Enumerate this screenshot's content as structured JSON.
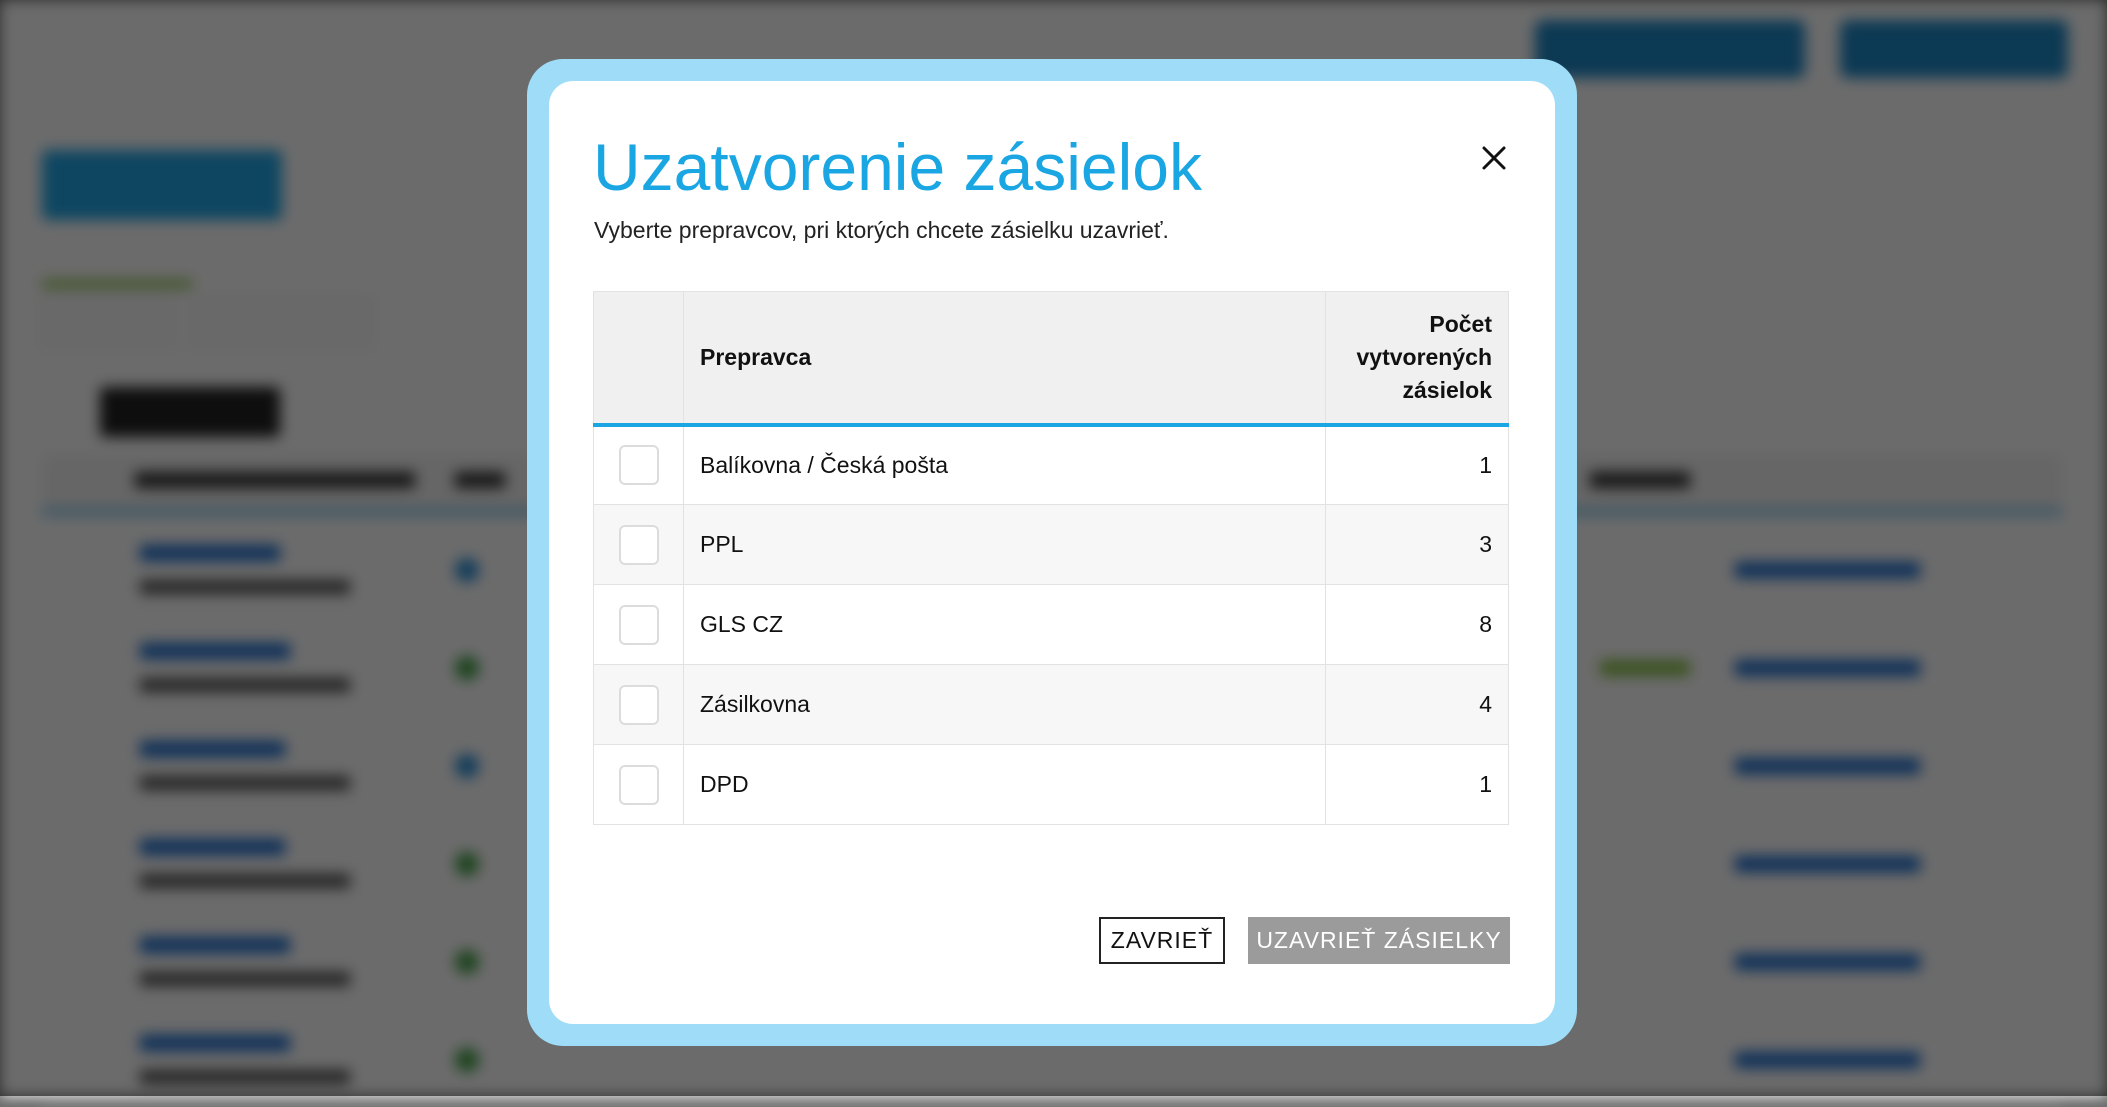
{
  "modal": {
    "title": "Uzatvorenie zásielok",
    "subtitle": "Vyberte prepravcov, pri ktorých chcete zásielku uzavrieť.",
    "table": {
      "header_carrier": "Prepravca",
      "header_count": "Počet vytvorených zásielok",
      "rows": [
        {
          "carrier": "Balíkovna / Česká pošta",
          "count": "1",
          "checked": false
        },
        {
          "carrier": "PPL",
          "count": "3",
          "checked": false
        },
        {
          "carrier": "GLS CZ",
          "count": "8",
          "checked": false
        },
        {
          "carrier": "Zásilkovna",
          "count": "4",
          "checked": false
        },
        {
          "carrier": "DPD",
          "count": "1",
          "checked": false
        }
      ]
    },
    "close_label": "ZAVRIEŤ",
    "confirm_label": "UZAVRIEŤ ZÁSIELKY",
    "close_icon": "close-icon"
  },
  "colors": {
    "accent": "#1aa6e2",
    "frame": "#9edcf7",
    "confirm_disabled": "#9b9b9b"
  }
}
